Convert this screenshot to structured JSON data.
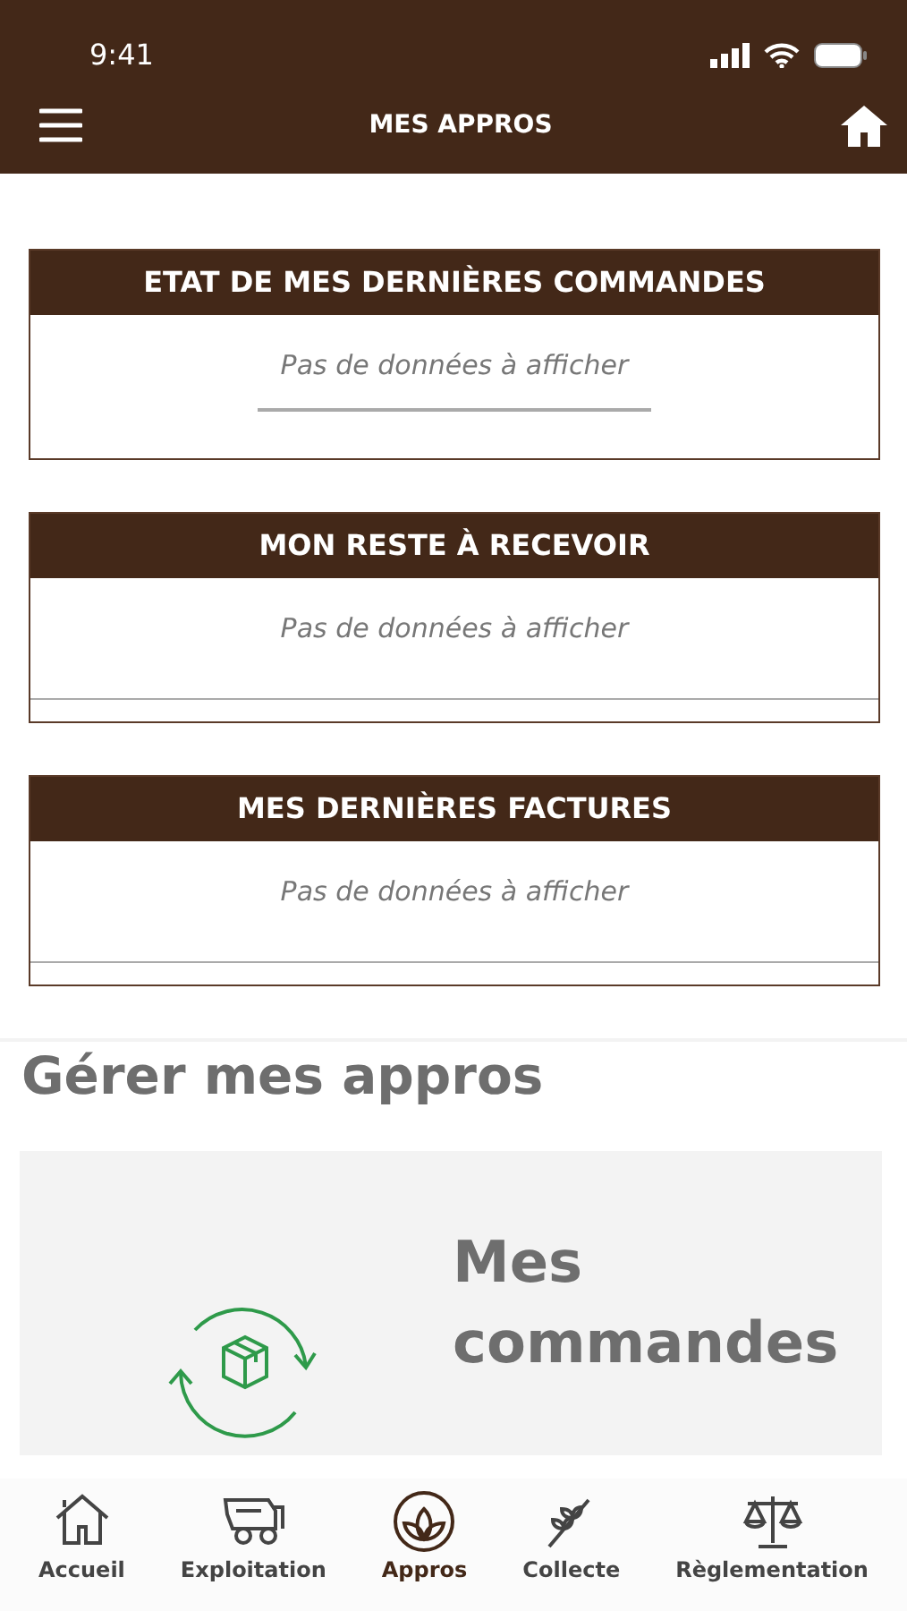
{
  "status_bar": {
    "time": "9:41"
  },
  "header": {
    "title": "MES APPROS"
  },
  "panels": [
    {
      "title": "ETAT DE MES DERNIÈRES COMMANDES",
      "empty_text": "Pas de données à afficher",
      "kind": "short-rule"
    },
    {
      "title": "MON RESTE À RECEVOIR",
      "empty_text": "Pas de données à afficher",
      "kind": "full-rule"
    },
    {
      "title": "MES DERNIÈRES FACTURES",
      "empty_text": "Pas de données à afficher",
      "kind": "full-rule"
    }
  ],
  "section": {
    "title": "Gérer mes appros",
    "cards": [
      {
        "title": "Mes commandes"
      }
    ]
  },
  "tab_bar": [
    {
      "label": "Accueil",
      "selected": false
    },
    {
      "label": "Exploitation",
      "selected": false
    },
    {
      "label": "Appros",
      "selected": true
    },
    {
      "label": "Collecte",
      "selected": false
    },
    {
      "label": "Règlementation",
      "selected": false
    }
  ]
}
